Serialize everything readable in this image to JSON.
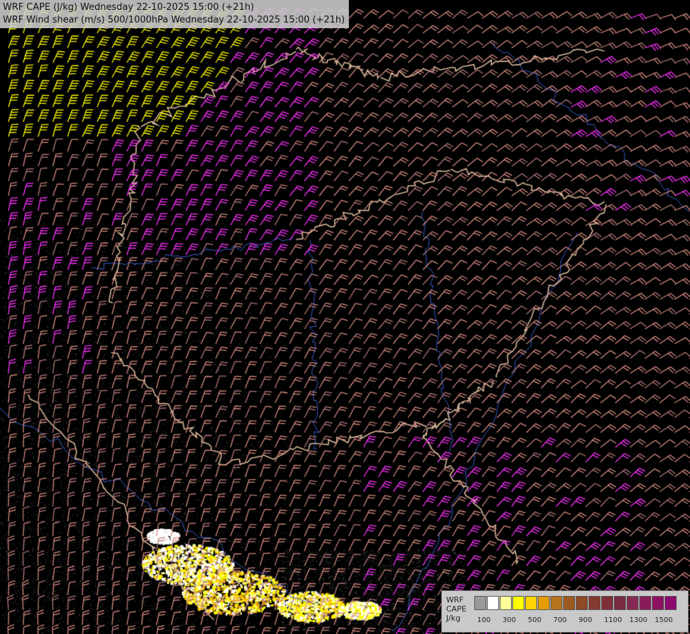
{
  "header": {
    "title_line_1": "WRF CAPE (J/kg) Wednesday 22-10-2025 15:00 (+21h)",
    "title_line_2": "WRF Wind shear (m/s) 500/1000hPa Wednesday 22-10-2025 15:00 (+21h)"
  },
  "legend": {
    "label_1": "WRF",
    "label_2": "CAPE",
    "unit": "J/kg",
    "ticks": [
      "100",
      "300",
      "500",
      "700",
      "900",
      "1100",
      "1300",
      "1500"
    ],
    "colors": [
      "#9a9a9a",
      "#ffffff",
      "#ffff99",
      "#ffff00",
      "#ffd200",
      "#e69b00",
      "#b8731f",
      "#9c5a1f",
      "#8c4a25",
      "#863a32",
      "#7e2e36",
      "#7a2a40",
      "#862a54",
      "#8a1c5a",
      "#8e1060",
      "#8a0a6e"
    ]
  },
  "barb_colors": {
    "low": "#d88d83",
    "mid": "#b87c7a",
    "high": "#ff33ff",
    "very_high": "#ffff00"
  }
}
